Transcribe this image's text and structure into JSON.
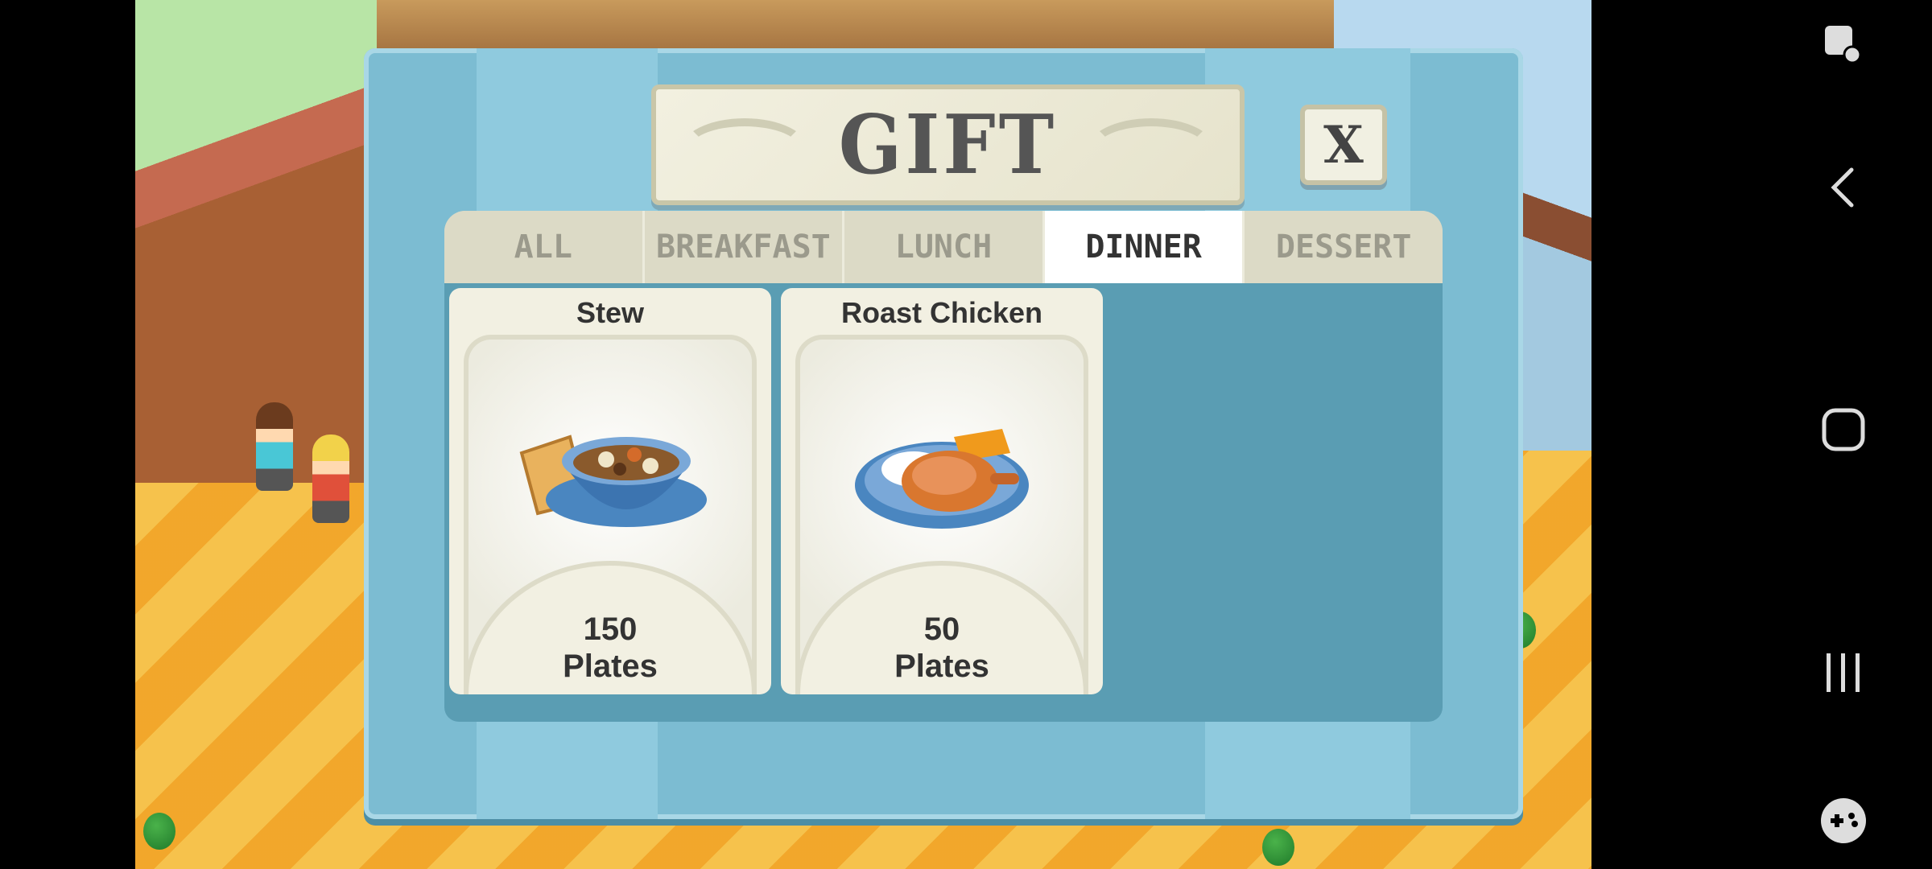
{
  "dialog": {
    "title": "GIFT",
    "close_label": "X"
  },
  "tabs": [
    {
      "label": "ALL",
      "active": false
    },
    {
      "label": "BREAKFAST",
      "active": false
    },
    {
      "label": "LUNCH",
      "active": false
    },
    {
      "label": "DINNER",
      "active": true
    },
    {
      "label": "DESSERT",
      "active": false
    }
  ],
  "items": [
    {
      "name": "Stew",
      "count": "150",
      "unit": "Plates",
      "icon": "stew-bowl-icon"
    },
    {
      "name": "Roast Chicken",
      "count": "50",
      "unit": "Plates",
      "icon": "roast-chicken-icon"
    }
  ],
  "nav": {
    "icons": [
      "screenshot-icon",
      "back-icon",
      "home-icon",
      "recents-icon",
      "game-tools-icon"
    ]
  },
  "colors": {
    "dialog_bg": "#7cbcd2",
    "content_bg": "#5a9db3",
    "tab_active": "#ffffff",
    "tab_inactive": "#dcdac6",
    "card_bg": "#f2f0e2"
  }
}
